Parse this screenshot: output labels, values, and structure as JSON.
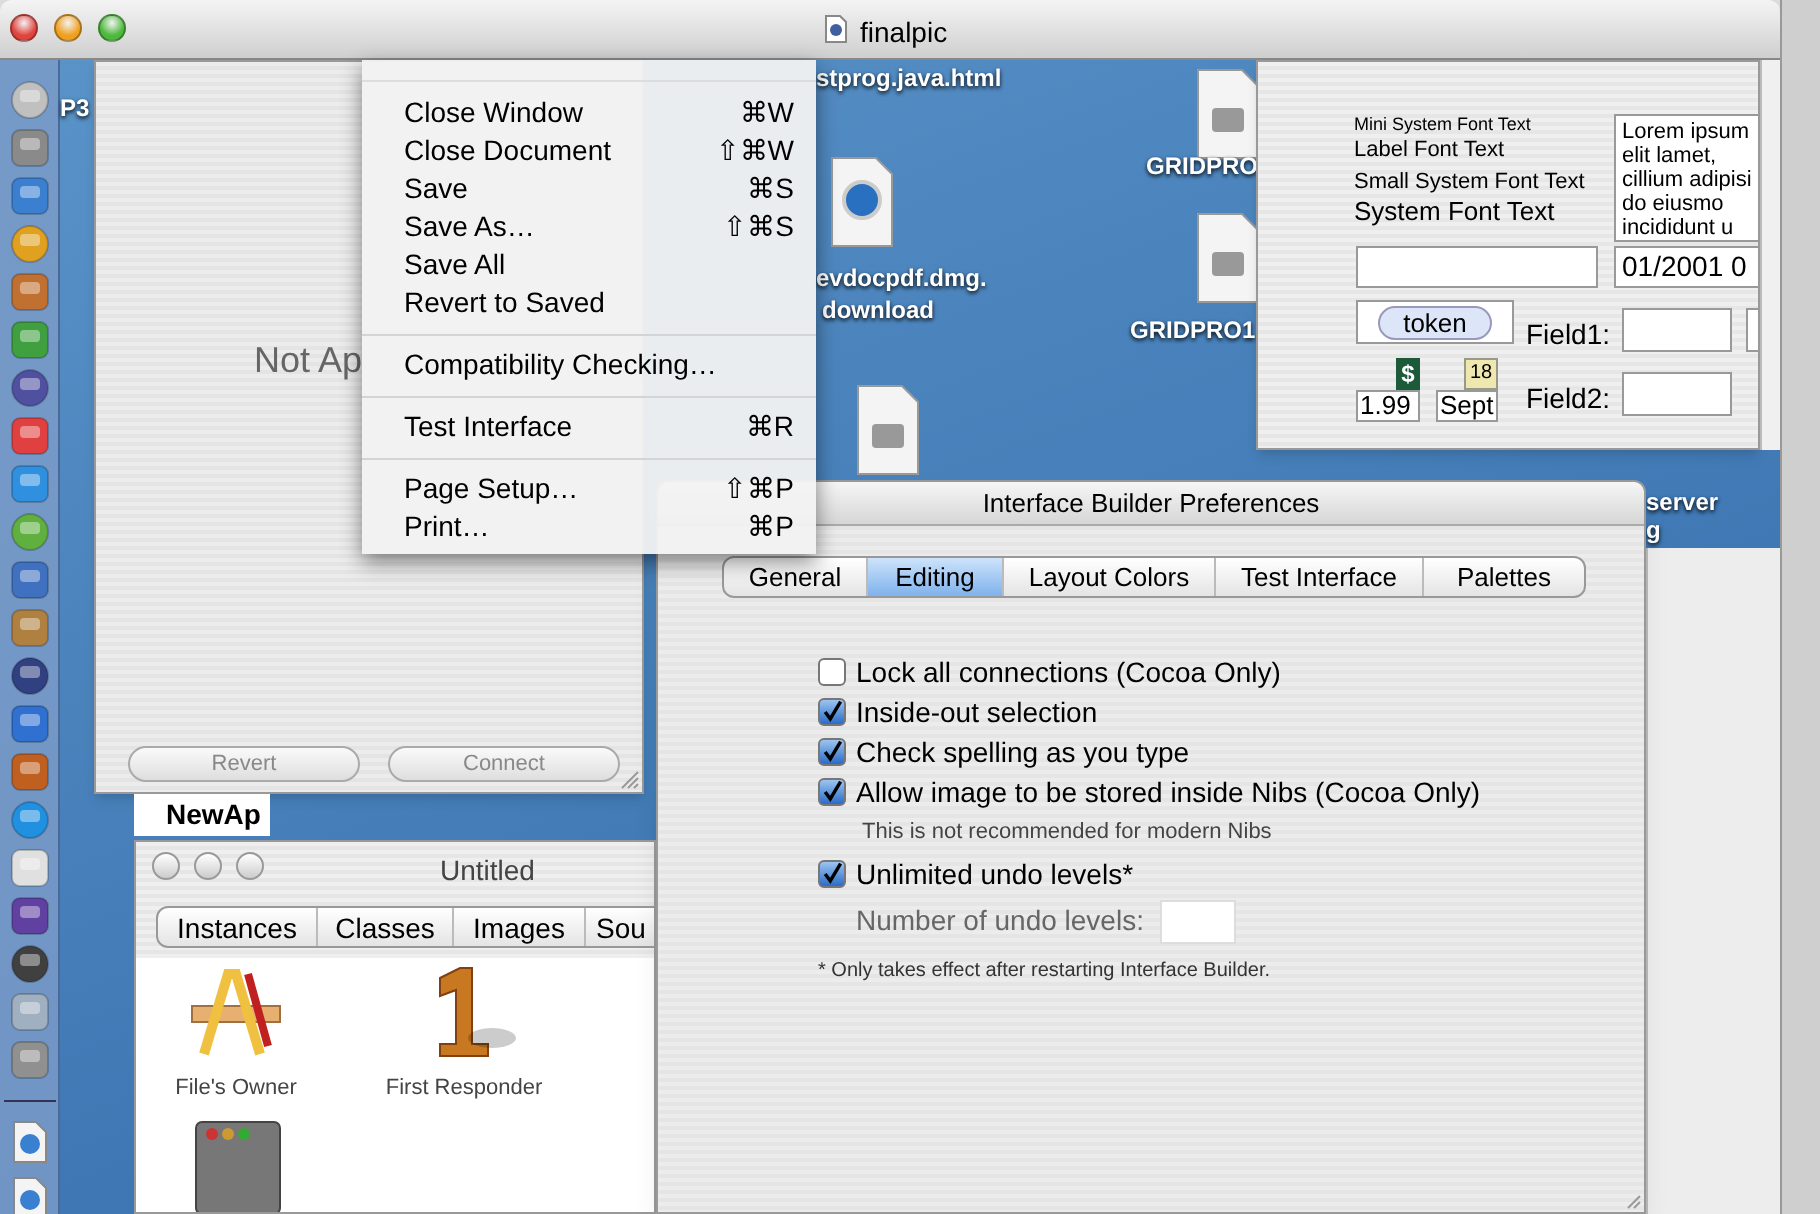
{
  "main_window": {
    "title": "finalpic"
  },
  "desktop": {
    "labels": [
      {
        "text": "P3"
      },
      {
        "text": "stprog.java.html"
      },
      {
        "text": "evdocpdf.dmg."
      },
      {
        "text": "download"
      },
      {
        "text": "GRIDPRO"
      },
      {
        "text": "GRIDPRO1"
      },
      {
        "text": "server"
      },
      {
        "text": "g"
      }
    ]
  },
  "inspector": {
    "message": "Not Ap",
    "buttons": [
      {
        "label": "Revert",
        "disabled": true
      },
      {
        "label": "Connect",
        "disabled": true
      }
    ]
  },
  "file_menu": {
    "items": [
      {
        "kind": "item",
        "label": "Close Window",
        "shortcut": "⌘W"
      },
      {
        "kind": "item",
        "label": "Close Document",
        "shortcut": "⇧⌘W"
      },
      {
        "kind": "item",
        "label": "Save",
        "shortcut": "⌘S"
      },
      {
        "kind": "item",
        "label": "Save As…",
        "shortcut": "⇧⌘S"
      },
      {
        "kind": "item",
        "label": "Save All"
      },
      {
        "kind": "item",
        "label": "Revert to Saved"
      },
      {
        "kind": "separator"
      },
      {
        "kind": "item",
        "label": "Compatibility Checking…"
      },
      {
        "kind": "separator"
      },
      {
        "kind": "item",
        "label": "Test Interface",
        "shortcut": "⌘R"
      },
      {
        "kind": "separator"
      },
      {
        "kind": "item",
        "label": "Page Setup…",
        "shortcut": "⇧⌘P"
      },
      {
        "kind": "item",
        "label": "Print…",
        "shortcut": "⌘P"
      }
    ]
  },
  "palette": {
    "font_samples": [
      "Mini System Font Text",
      "Label Font Text",
      "Small System Font Text",
      "System Font Text"
    ],
    "text_view": [
      "Lorem ipsum",
      "elit lamet,",
      "cillium adipisi",
      "do eiusmo",
      "incididunt u"
    ],
    "date_field": "01/2001 0",
    "token": "token",
    "field_labels": [
      "Field1:",
      "Field2:"
    ],
    "number_formatter": "1.99",
    "date_formatter": "Sept",
    "currency_badge": "$",
    "calendar_badge": "18"
  },
  "name_field": {
    "value": "NewAp"
  },
  "document_window": {
    "title": "Untitled",
    "tabs": [
      {
        "label": "Instances"
      },
      {
        "label": "Classes"
      },
      {
        "label": "Images"
      },
      {
        "label": "Sou"
      }
    ],
    "items": [
      {
        "kind": "owner",
        "label": "File's Owner"
      },
      {
        "kind": "responder",
        "label": "First Responder"
      },
      {
        "kind": "window"
      }
    ]
  },
  "preferences": {
    "title": "Interface Builder Preferences",
    "tabs": [
      {
        "label": "General",
        "selected": false
      },
      {
        "label": "Editing",
        "selected": true
      },
      {
        "label": "Layout Colors",
        "selected": false
      },
      {
        "label": "Test Interface",
        "selected": false
      },
      {
        "label": "Palettes",
        "selected": false
      }
    ],
    "options": [
      {
        "kind": "checkbox",
        "label": "Lock all connections (Cocoa Only)",
        "checked": false
      },
      {
        "kind": "checkbox",
        "label": "Inside-out selection",
        "checked": true
      },
      {
        "kind": "checkbox",
        "label": "Check spelling as you type",
        "checked": true
      },
      {
        "kind": "checkbox",
        "label": "Allow image to be stored inside Nibs (Cocoa Only)",
        "checked": true
      },
      {
        "kind": "note",
        "text": "This is not recommended for modern Nibs"
      },
      {
        "kind": "checkbox",
        "label": "Unlimited undo levels*",
        "checked": true
      },
      {
        "kind": "number_field",
        "label": "Number of undo levels:"
      },
      {
        "kind": "footnote",
        "text": "* Only takes effect after restarting Interface Builder."
      }
    ]
  }
}
